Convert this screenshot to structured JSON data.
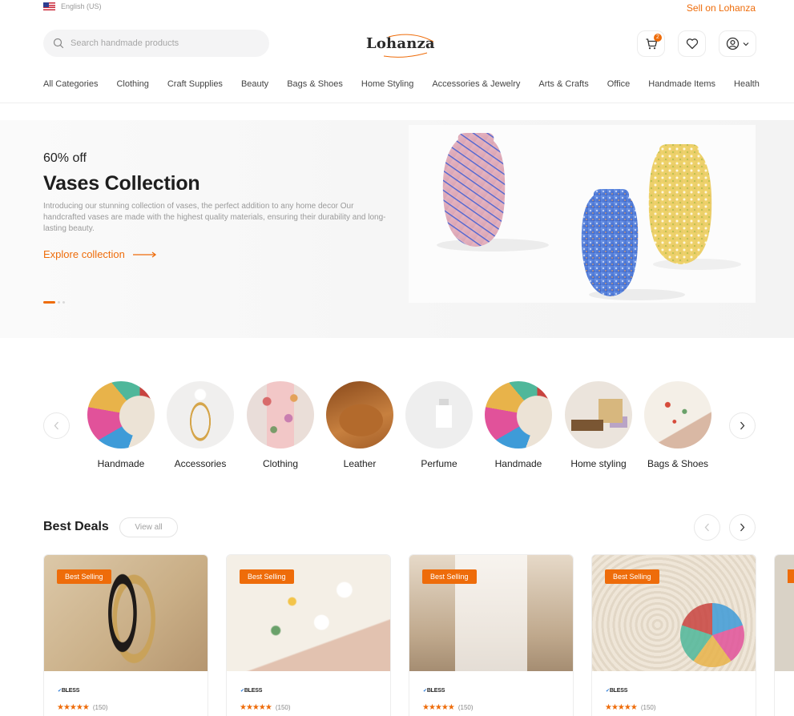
{
  "topbar": {
    "language": "English (US)",
    "sell_link": "Sell on Lohanza"
  },
  "header": {
    "search_placeholder": "Search handmade products",
    "logo": "Lohanza",
    "cart_count": "2"
  },
  "nav": {
    "items": [
      "All Categories",
      "Clothing",
      "Craft Supplies",
      "Beauty",
      "Bags & Shoes",
      "Home Styling",
      "Accessories & Jewelry",
      "Arts & Crafts",
      "Office",
      "Handmade Items",
      "Health"
    ]
  },
  "hero": {
    "discount": "60% off",
    "title": "Vases Collection",
    "description": "Introducing our stunning collection of vases, the perfect addition to any home decor Our handcrafted vases are made with the highest quality materials, ensuring their durability and long-lasting beauty.",
    "cta": "Explore collection"
  },
  "categories": {
    "items": [
      {
        "label": "Handmade"
      },
      {
        "label": "Accessories"
      },
      {
        "label": "Clothing"
      },
      {
        "label": "Leather"
      },
      {
        "label": "Perfume"
      },
      {
        "label": "Handmade"
      },
      {
        "label": "Home styling"
      },
      {
        "label": "Bags & Shoes"
      }
    ]
  },
  "deals": {
    "title": "Best Deals",
    "view_all": "View all",
    "cards": [
      {
        "badge": "Best Selling",
        "brand": "BLESS",
        "stars": "★★★★★",
        "rating_count": "(150)"
      },
      {
        "badge": "Best Selling",
        "brand": "BLESS",
        "stars": "★★★★★",
        "rating_count": "(150)"
      },
      {
        "badge": "Best Selling",
        "brand": "BLESS",
        "stars": "★★★★★",
        "rating_count": "(150)"
      },
      {
        "badge": "Best Selling",
        "brand": "BLESS",
        "stars": "★★★★★",
        "rating_count": "(150)"
      }
    ]
  },
  "colors": {
    "accent": "#ee6c0a",
    "text": "#222222",
    "muted": "#9a9a9a"
  }
}
